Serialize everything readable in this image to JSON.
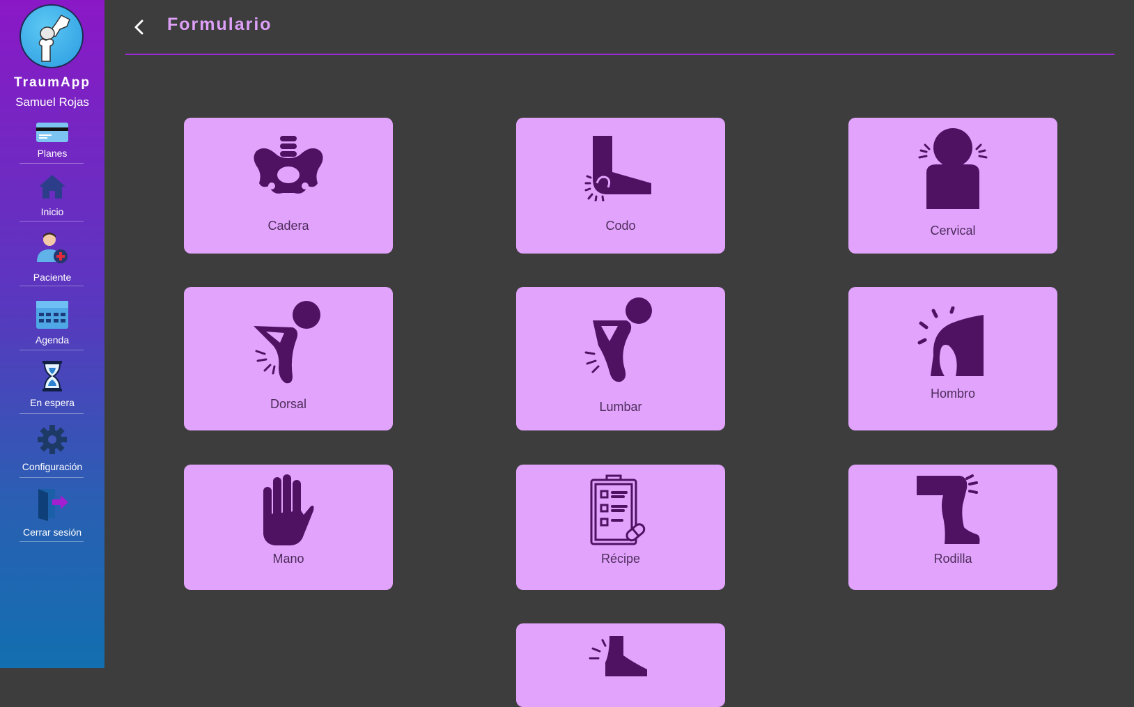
{
  "sidebar": {
    "app_name": "TraumApp",
    "user_name": "Samuel Rojas",
    "logo_icon": "bone-joint-icon",
    "items": [
      {
        "label": "Planes",
        "icon": "credit-card-icon"
      },
      {
        "label": "Inicio",
        "icon": "home-icon"
      },
      {
        "label": "Paciente",
        "icon": "patient-add-icon"
      },
      {
        "label": "Agenda",
        "icon": "calendar-icon"
      },
      {
        "label": "En espera",
        "icon": "hourglass-icon"
      },
      {
        "label": "Configuración",
        "icon": "gear-icon"
      },
      {
        "label": "Cerrar sesión",
        "icon": "logout-icon"
      }
    ]
  },
  "header": {
    "title": "Formulario",
    "back_icon": "chevron-left-icon"
  },
  "cards": [
    {
      "label": "Cadera",
      "icon": "pelvis-icon"
    },
    {
      "label": "Codo",
      "icon": "elbow-pain-icon"
    },
    {
      "label": "Cervical",
      "icon": "neck-pain-icon"
    },
    {
      "label": "Dorsal",
      "icon": "back-pain-icon"
    },
    {
      "label": "Lumbar",
      "icon": "lower-back-pain-icon"
    },
    {
      "label": "Hombro",
      "icon": "shoulder-pain-icon"
    },
    {
      "label": "Mano",
      "icon": "hand-icon"
    },
    {
      "label": "Récipe",
      "icon": "prescription-clipboard-icon"
    },
    {
      "label": "Rodilla",
      "icon": "knee-pain-icon"
    },
    {
      "label": "",
      "icon": "ankle-pain-icon"
    }
  ],
  "colors": {
    "sidebar_top": "#8b18c6",
    "sidebar_bottom": "#126fb0",
    "background": "#3d3d3d",
    "card": "#e1a3fc",
    "icon": "#4f1263",
    "title": "#dea0f9",
    "rule": "#9b2ad6"
  }
}
